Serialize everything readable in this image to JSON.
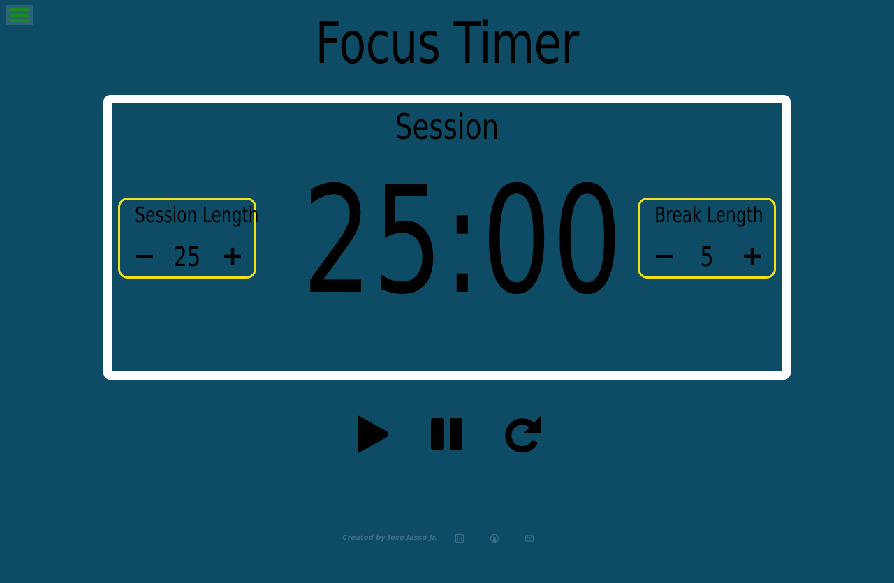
{
  "app": {
    "title": "Focus Timer"
  },
  "menu": {
    "icon": "hamburger-menu-icon",
    "color": "#1d8a1d"
  },
  "timer": {
    "label": "Session",
    "time": "25:00",
    "frame_color": "#ffffff"
  },
  "session_length": {
    "title": "Session Length",
    "decrement_label": "−",
    "value": "25",
    "increment_label": "+"
  },
  "break_length": {
    "title": "Break Length",
    "decrement_label": "−",
    "value": "5",
    "increment_label": "+"
  },
  "controls": {
    "play_icon": "play-icon",
    "pause_icon": "pause-icon",
    "reset_icon": "redo-icon"
  },
  "footer": {
    "credit": "Created by Jose Jasso Jr.",
    "links": [
      "linkedin-icon",
      "github-icon",
      "email-icon"
    ]
  },
  "colors": {
    "background": "#0e4b64",
    "length_border": "#f0e11d",
    "text": "#000000",
    "footer_text": "#3d6f83"
  }
}
